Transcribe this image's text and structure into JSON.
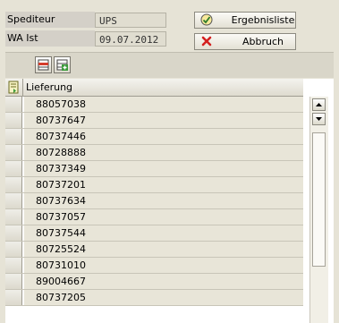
{
  "form": {
    "spediteur_label": "Spediteur",
    "spediteur_value": "UPS",
    "wa_ist_label": "WA Ist",
    "wa_ist_value": "09.07.2012"
  },
  "buttons": {
    "ergebnisliste": "Ergebnisliste",
    "abbruch": "Abbruch"
  },
  "table": {
    "header": "Lieferung",
    "rows": [
      "88057038",
      "80737647",
      "80737446",
      "80728888",
      "80737349",
      "80737201",
      "80737634",
      "80737057",
      "80737544",
      "80725524",
      "80731010",
      "89004667",
      "80737205"
    ]
  },
  "icons": {
    "ergebnisliste": "checkmark-circle-icon",
    "abbruch": "red-x-icon",
    "toolbar_1": "delete-row-icon",
    "toolbar_2": "insert-row-icon",
    "select_all": "select-all-icon"
  }
}
